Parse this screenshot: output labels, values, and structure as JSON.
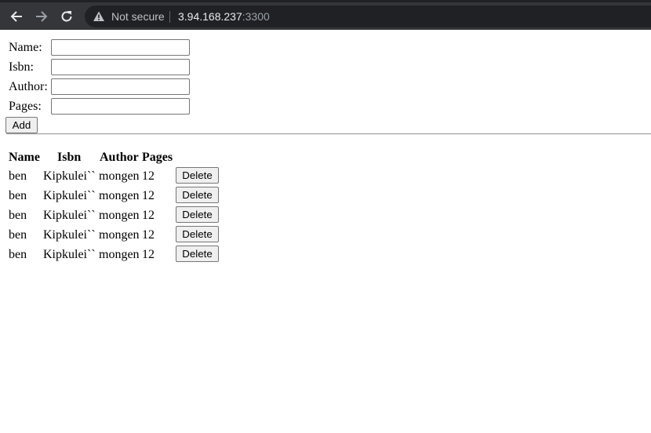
{
  "browser": {
    "security_label": "Not secure",
    "url_host": "3.94.168.237",
    "url_port": ":3300"
  },
  "form": {
    "fields": [
      {
        "label": "Name:",
        "value": ""
      },
      {
        "label": "Isbn:",
        "value": ""
      },
      {
        "label": "Author:",
        "value": ""
      },
      {
        "label": "Pages:",
        "value": ""
      }
    ],
    "add_label": "Add"
  },
  "table": {
    "headers": [
      "Name",
      "Isbn",
      "Author",
      "Pages"
    ],
    "rows": [
      {
        "name": "ben",
        "isbn": "Kipkulei``",
        "author": "mongen",
        "pages": "12",
        "action": "Delete"
      },
      {
        "name": "ben",
        "isbn": "Kipkulei``",
        "author": "mongen",
        "pages": "12",
        "action": "Delete"
      },
      {
        "name": "ben",
        "isbn": "Kipkulei``",
        "author": "mongen",
        "pages": "12",
        "action": "Delete"
      },
      {
        "name": "ben",
        "isbn": "Kipkulei``",
        "author": "mongen",
        "pages": "12",
        "action": "Delete"
      },
      {
        "name": "ben",
        "isbn": "Kipkulei``",
        "author": "mongen",
        "pages": "12",
        "action": "Delete"
      }
    ]
  }
}
